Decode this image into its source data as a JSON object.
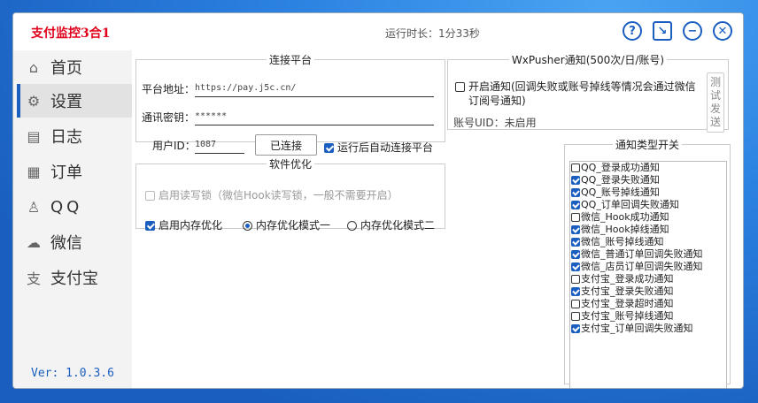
{
  "app": {
    "title": "支付监控3合1",
    "runtime": "运行时长：1分33秒",
    "version": "Ver: 1.0.3.6"
  },
  "nav": [
    {
      "label": "首页",
      "icon": "home-icon"
    },
    {
      "label": "设置",
      "icon": "gear-icon",
      "active": true
    },
    {
      "label": "日志",
      "icon": "clipboard-icon"
    },
    {
      "label": "订单",
      "icon": "order-search-icon"
    },
    {
      "label": "QQ",
      "icon": "penguin-icon"
    },
    {
      "label": "微信",
      "icon": "wechat-icon"
    },
    {
      "label": "支付宝",
      "icon": "alipay-icon"
    }
  ],
  "connect": {
    "legend": "连接平台",
    "platform_label": "平台地址：",
    "platform_value": "https://pay.j5c.cn/",
    "key_label": "通讯密钥：",
    "key_value": "******",
    "uid_label": "用户ID：",
    "uid_value": "1087",
    "connect_button": "已连接",
    "auto_connect": "运行后自动连接平台",
    "auto_connect_checked": true
  },
  "optimize": {
    "legend": "软件优化",
    "rw_lock": "启用读写锁（微信Hook读写锁，一般不需要开启）",
    "mem_opt": "启用内存优化",
    "mem_opt_checked": true,
    "mode1": "内存优化模式一",
    "mode2": "内存优化模式二",
    "selected_mode": 1
  },
  "wxpusher": {
    "legend": "WxPusher通知(500次/日/账号)",
    "enable_line1": "开启通知(回调失败或账号掉线等情况会通过微信",
    "enable_line2": "订阅号通知)",
    "uid_label": "账号UID：未启用",
    "test_button": "测试发送"
  },
  "notify": {
    "legend": "通知类型开关",
    "items": [
      {
        "label": "QQ_登录成功通知",
        "on": false
      },
      {
        "label": "QQ_登录失败通知",
        "on": true
      },
      {
        "label": "QQ_账号掉线通知",
        "on": true
      },
      {
        "label": "QQ_订单回调失败通知",
        "on": true
      },
      {
        "label": "微信_Hook成功通知",
        "on": false
      },
      {
        "label": "微信_Hook掉线通知",
        "on": true
      },
      {
        "label": "微信_账号掉线通知",
        "on": true
      },
      {
        "label": "微信_普通订单回调失败通知",
        "on": true
      },
      {
        "label": "微信_店员订单回调失败通知",
        "on": true
      },
      {
        "label": "支付宝_登录成功通知",
        "on": false
      },
      {
        "label": "支付宝_登录失败通知",
        "on": true
      },
      {
        "label": "支付宝_登录超时通知",
        "on": false
      },
      {
        "label": "支付宝_账号掉线通知",
        "on": false
      },
      {
        "label": "支付宝_订单回调失败通知",
        "on": true
      }
    ]
  },
  "colors": {
    "accent": "#1a5fbf",
    "title_red": "#e0001a"
  }
}
